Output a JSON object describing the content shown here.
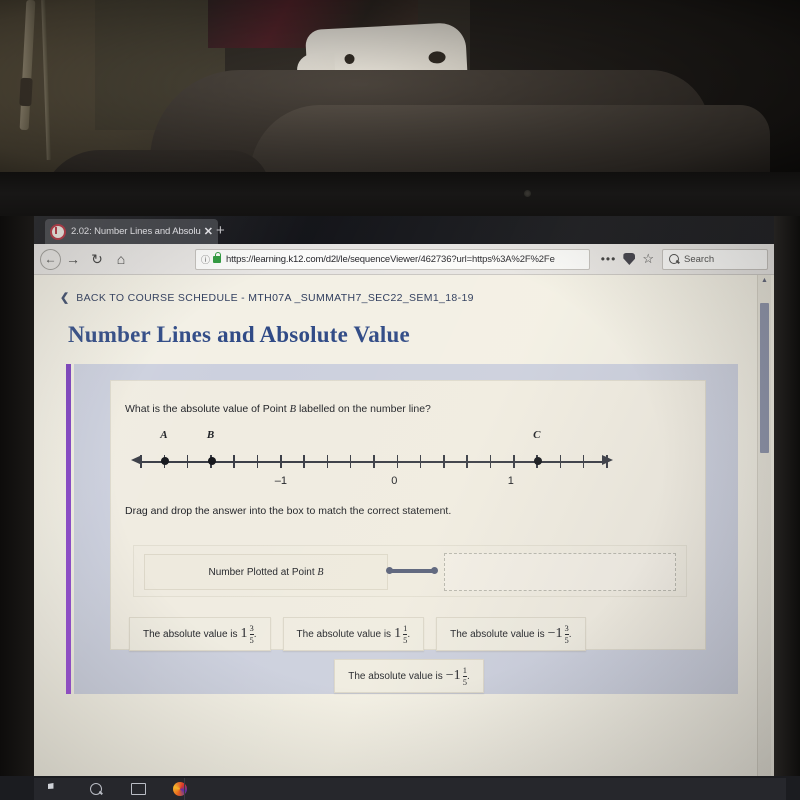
{
  "browser": {
    "tab": {
      "title": "2.02: Number Lines and Absolu",
      "close_label": "✕",
      "favicon": "circle-b-favicon"
    },
    "newtab_label": "+",
    "nav": {
      "back_label": "←",
      "forward_label": "→",
      "reload_label": "↻",
      "home_label": "⌂"
    },
    "url": {
      "info_label": "ⓘ",
      "value": "https://learning.k12.com/d2l/le/sequenceViewer/462736?url=https%3A%2F%2Fe",
      "secure": true
    },
    "toolbar": {
      "overflow_label": "•••",
      "pocket_label": "pocket-icon",
      "bookmark_label": "☆"
    },
    "search": {
      "placeholder": "Search"
    }
  },
  "page": {
    "back_link": {
      "chevron": "❮",
      "label": "BACK TO COURSE SCHEDULE - MTH07A _SUMMATH7_SEC22_SEM1_18-19"
    },
    "title": "Number Lines and Absolute Value",
    "question": {
      "prefix": "What is the absolute value of Point ",
      "point": "B",
      "suffix": " labelled on the number line?"
    },
    "instruction": "Drag and drop the answer into the box to match the correct statement.",
    "match": {
      "prompt_prefix": "Number Plotted at Point ",
      "prompt_point": "B",
      "dropzone_label": "",
      "connector": "match-connector"
    },
    "options": [
      {
        "prefix": "The absolute value is ",
        "sign": "",
        "whole": "1",
        "num": "3",
        "den": "5",
        "suffix": "."
      },
      {
        "prefix": "The absolute value is ",
        "sign": "",
        "whole": "1",
        "num": "1",
        "den": "5",
        "suffix": "."
      },
      {
        "prefix": "The absolute value is ",
        "sign": "−",
        "whole": "1",
        "num": "3",
        "den": "5",
        "suffix": "."
      },
      {
        "prefix": "The absolute value is ",
        "sign": "−",
        "whole": "1",
        "num": "1",
        "den": "5",
        "suffix": "."
      }
    ]
  },
  "number_line": {
    "axis_labels": [
      "–1",
      "0",
      "1"
    ],
    "axis_label_values": [
      -1,
      0,
      1
    ],
    "tick_step": 0.2,
    "range": [
      -2.2,
      1.8
    ],
    "points": [
      {
        "label": "A",
        "value": -2.0
      },
      {
        "label": "B",
        "value": -1.6
      },
      {
        "label": "C",
        "value": 1.2
      }
    ]
  },
  "scrollbar": {
    "up_arrow": "▲"
  },
  "taskbar": {
    "items": [
      "start-icon",
      "search-icon",
      "task-view-icon",
      "firefox-icon"
    ]
  },
  "colors": {
    "title_blue": "#2f4a86",
    "accent_purple": "#8b49cc",
    "panel_blue": "#ccd0de",
    "page_cream": "#f3f0e5",
    "connector": "#59617a"
  }
}
